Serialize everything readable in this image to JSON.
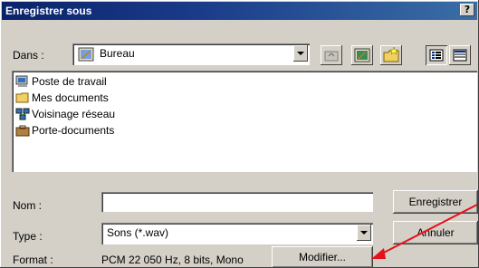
{
  "title": "Enregistrer sous",
  "help_label": "?",
  "dans": {
    "label": "Dans :",
    "value": "Bureau"
  },
  "toolbar_icons": [
    "up-folder-icon",
    "desktop-icon",
    "new-folder-icon",
    "list-view-icon",
    "details-view-icon"
  ],
  "files": [
    {
      "label": "Poste de travail",
      "icon": "computer-icon"
    },
    {
      "label": "Mes documents",
      "icon": "folder-icon"
    },
    {
      "label": "Voisinage réseau",
      "icon": "network-icon"
    },
    {
      "label": "Porte-documents",
      "icon": "briefcase-icon"
    }
  ],
  "nom": {
    "label": "Nom :",
    "value": ""
  },
  "type": {
    "label": "Type :",
    "value": "Sons (*.wav)"
  },
  "format": {
    "label": "Format :",
    "value": "PCM 22 050 Hz, 8 bits, Mono"
  },
  "buttons": {
    "save": "Enregistrer",
    "cancel": "Annuler",
    "modify": "Modifier..."
  },
  "colors": {
    "titlebar": "#0a246a",
    "face": "#d4d0c8",
    "arrow": "#e8101a"
  }
}
